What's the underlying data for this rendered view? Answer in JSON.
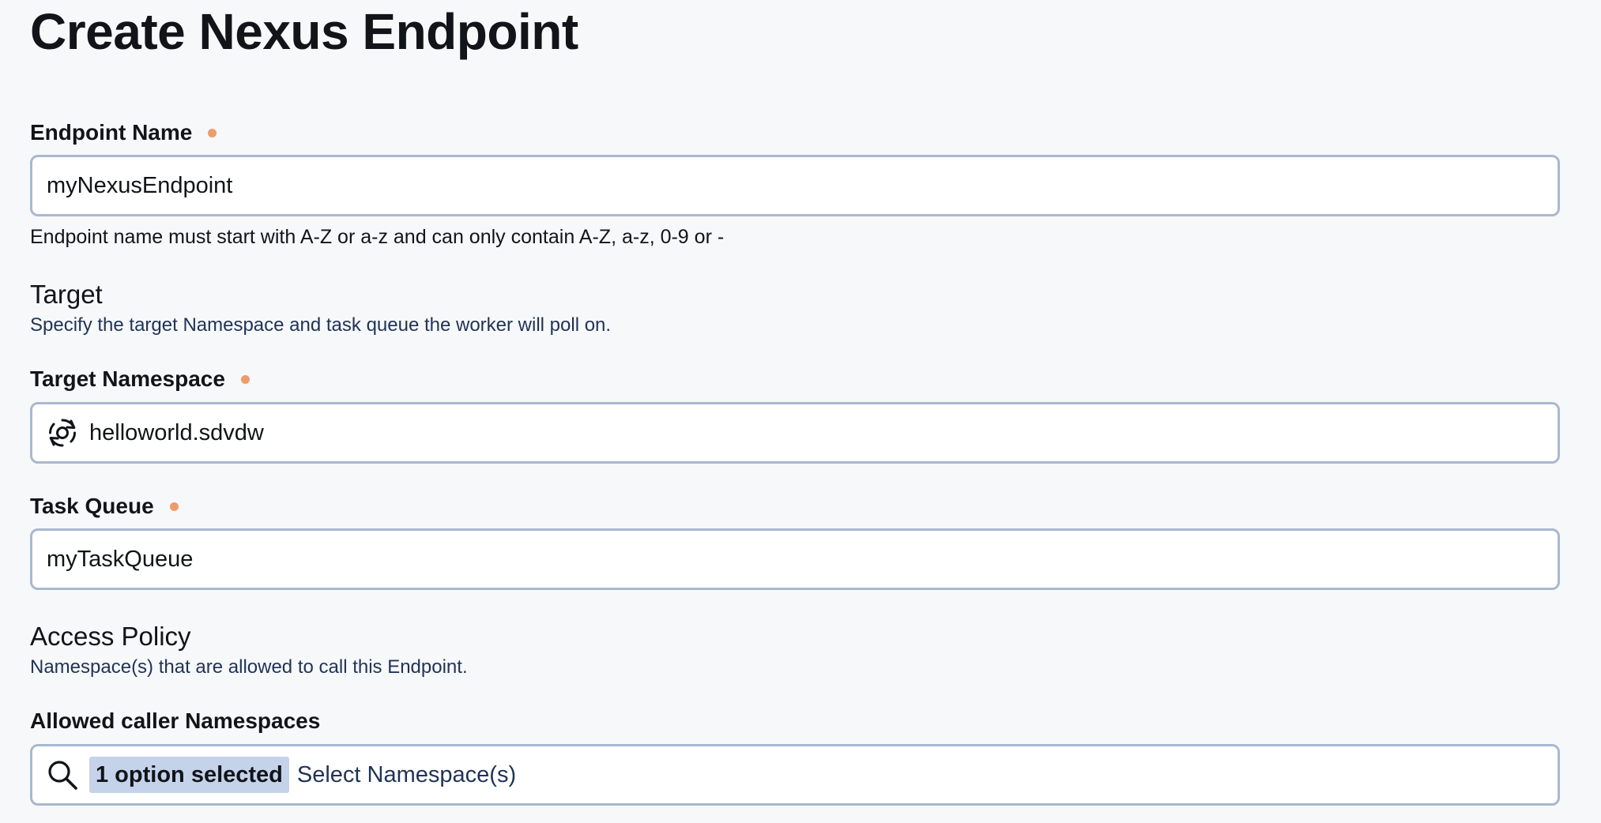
{
  "page": {
    "title": "Create Nexus Endpoint"
  },
  "endpoint_name": {
    "label": "Endpoint Name",
    "value": "myNexusEndpoint",
    "hint": "Endpoint name must start with A-Z or a-z and can only contain A-Z, a-z, 0-9 or -"
  },
  "target": {
    "title": "Target",
    "description": "Specify the target Namespace and task queue the worker will poll on."
  },
  "target_namespace": {
    "label": "Target Namespace",
    "value": "helloworld.sdvdw",
    "icon": "namespace-sync-icon"
  },
  "task_queue": {
    "label": "Task Queue",
    "value": "myTaskQueue"
  },
  "access_policy": {
    "title": "Access Policy",
    "description": "Namespace(s) that are allowed to call this Endpoint."
  },
  "allowed_callers": {
    "label": "Allowed caller Namespaces",
    "selected_chip": "1 option selected",
    "placeholder": "Select Namespace(s)",
    "icon": "search-icon"
  },
  "colors": {
    "required_dot": "#ef9b6a",
    "input_border": "#a9b8cf",
    "chip_bg": "#c4d3ea",
    "description_text": "#1f3356"
  }
}
